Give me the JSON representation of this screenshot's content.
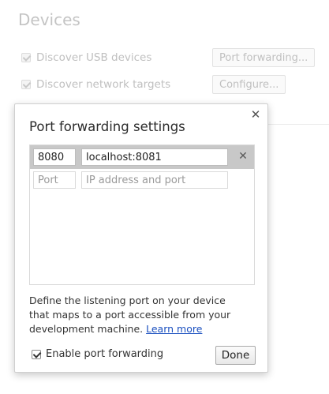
{
  "background": {
    "title": "Devices",
    "options": [
      {
        "label": "Discover USB devices",
        "checked": true,
        "button_label": "Port forwarding..."
      },
      {
        "label": "Discover network targets",
        "checked": true,
        "button_label": "Configure..."
      }
    ]
  },
  "dialog": {
    "title": "Port forwarding settings",
    "close_icon": "close-icon",
    "rules": [
      {
        "port": "8080",
        "address": "localhost:8081",
        "delete_icon": "close-icon"
      }
    ],
    "new_rule": {
      "port_placeholder": "Port",
      "address_placeholder": "IP address and port"
    },
    "description": "Define the listening port on your device that maps to a port accessible from your development machine.",
    "learn_more": "Learn more",
    "enable_label": "Enable port forwarding",
    "enable_checked": true,
    "done_label": "Done"
  }
}
